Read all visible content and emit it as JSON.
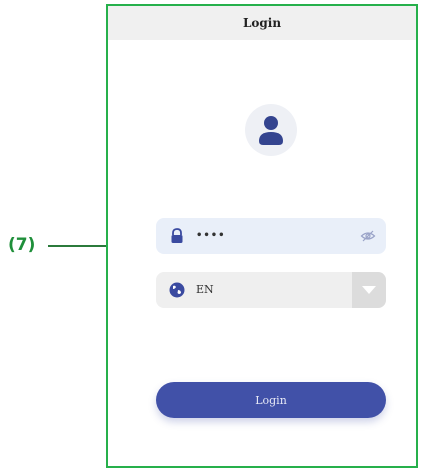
{
  "annotation": {
    "label": "(7)"
  },
  "header": {
    "title": "Login"
  },
  "password": {
    "value": "••••"
  },
  "language": {
    "value": "EN"
  },
  "login_button": {
    "label": "Login"
  },
  "colors": {
    "frame_border": "#26b04b",
    "primary": "#4151a8",
    "annotation": "#1f8f3a"
  },
  "icons": {
    "avatar": "user-icon",
    "password": "lock-icon",
    "visibility": "eye-off-icon",
    "language": "globe-icon",
    "dropdown": "chevron-down-icon"
  }
}
